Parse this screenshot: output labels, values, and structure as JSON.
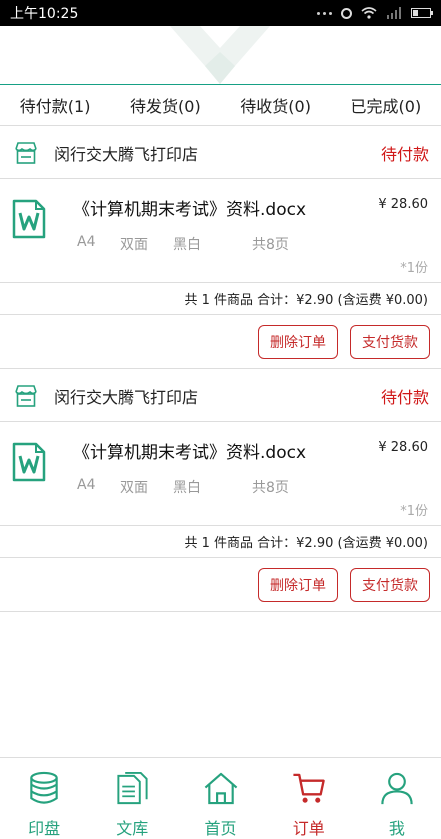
{
  "status_bar": {
    "time": "上午10:25",
    "battery_level": 0.3
  },
  "tabs": [
    {
      "label": "待付款(1)"
    },
    {
      "label": "待发货(0)"
    },
    {
      "label": "待收货(0)"
    },
    {
      "label": "已完成(0)"
    }
  ],
  "orders": [
    {
      "shop_name": "闵行交大腾飞打印店",
      "status": "待付款",
      "item": {
        "name": "《计算机期末考试》资料.docx",
        "price": "¥ 28.60",
        "paper": "A4",
        "sides": "双面",
        "color": "黑白",
        "pages": "共8页",
        "qty": "*1份"
      },
      "summary": "共 1 件商品   合计：¥2.90  (含运费 ¥0.00)",
      "delete_label": "删除订单",
      "pay_label": "支付货款"
    },
    {
      "shop_name": "闵行交大腾飞打印店",
      "status": "待付款",
      "item": {
        "name": "《计算机期末考试》资料.docx",
        "price": "¥ 28.60",
        "paper": "A4",
        "sides": "双面",
        "color": "黑白",
        "pages": "共8页",
        "qty": "*1份"
      },
      "summary": "共 1 件商品   合计：¥2.90  (含运费 ¥0.00)",
      "delete_label": "删除订单",
      "pay_label": "支付货款"
    }
  ],
  "nav": [
    {
      "label": "印盘",
      "icon": "database-icon"
    },
    {
      "label": "文库",
      "icon": "documents-icon"
    },
    {
      "label": "首页",
      "icon": "home-icon"
    },
    {
      "label": "订单",
      "icon": "cart-icon",
      "active": true
    },
    {
      "label": "我",
      "icon": "user-icon"
    }
  ],
  "colors": {
    "accent": "#16a085",
    "alert": "#d01818",
    "nav_green": "#26a27e"
  }
}
